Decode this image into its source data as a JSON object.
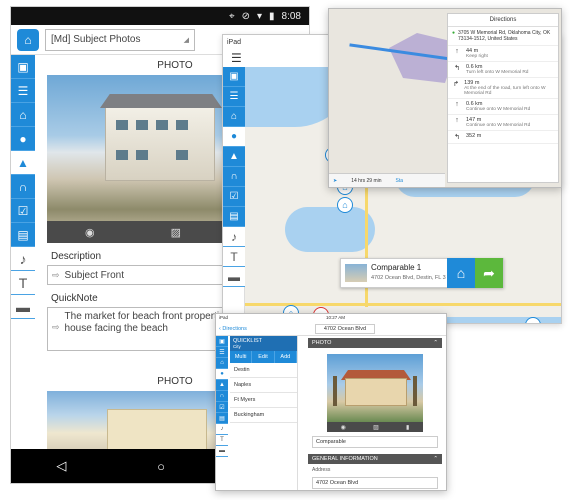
{
  "android": {
    "status": {
      "time": "8:08"
    },
    "header": {
      "select_value": "[Md] Subject Photos"
    },
    "sections": {
      "photo_title": "PHOTO",
      "description_label": "Description",
      "description_value": "Subject Front",
      "quicknote_label": "QuickNote",
      "quicknote_value": "The market for beach front properties portion of the house facing the beach",
      "photo2_title": "PHOTO"
    }
  },
  "ipad": {
    "status_label": "iPad",
    "menu_icon": "hamburger-icon",
    "callout": {
      "title": "Comparable 1",
      "address": "4702 Ocean Blvd, Destin, FL 3",
      "home_color": "#1f8ad8",
      "directions_color": "#5cb83c"
    }
  },
  "directions": {
    "title": "Directions",
    "destination": "3705 W Memorial Rd, Oklahoma City, OK 73134-1512, United States",
    "steps": [
      {
        "arrow": "↑",
        "distance": "44 m",
        "note": "Keep right"
      },
      {
        "arrow": "↰",
        "distance": "0.6 km",
        "note": "Turn left onto W Memorial Rd"
      },
      {
        "arrow": "↱",
        "distance": "139 m",
        "note": "At the end of the road, turn left onto W Memorial Rd"
      },
      {
        "arrow": "↑",
        "distance": "0.6 km",
        "note": "Continue onto W Memorial Rd"
      },
      {
        "arrow": "↑",
        "distance": "147 m",
        "note": "Continue onto W Memorial Rd"
      },
      {
        "arrow": "↰",
        "distance": "352 m",
        "note": ""
      }
    ],
    "footer_time": "14 hrs 29 min",
    "footer_start": "Sta"
  },
  "detail": {
    "status": {
      "device": "iPad",
      "time": "10:27 AM"
    },
    "back_label": "Directions",
    "address": "4702 Ocean Blvd",
    "quicklist": {
      "title": "QUICKLIST",
      "subtitle": "City",
      "buttons": [
        "Multi",
        "Edit",
        "Add"
      ],
      "items": [
        "Destin",
        "Naples",
        "Ft Myers",
        "Buckingham"
      ]
    },
    "photo_section": "PHOTO",
    "photo_caption": "Comparable",
    "general_section": "GENERAL INFORMATION",
    "address_label": "Address",
    "address_value": "4702 Ocean Blvd"
  }
}
